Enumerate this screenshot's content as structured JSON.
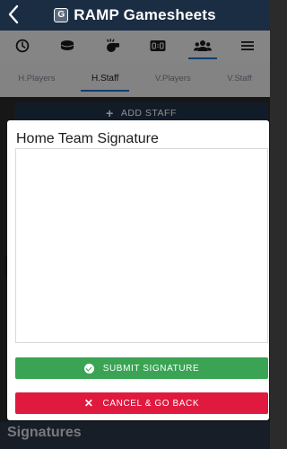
{
  "header": {
    "title": "RAMP Gamesheets",
    "logo_letter": "G",
    "back_icon": "chevron-left-icon"
  },
  "icon_bar": {
    "items": [
      {
        "icon": "clock-icon",
        "active": false
      },
      {
        "icon": "hockey-puck-icon",
        "active": false
      },
      {
        "icon": "whistle-icon",
        "active": false
      },
      {
        "icon": "scoreboard-icon",
        "active": false
      },
      {
        "icon": "team-people-icon",
        "active": true
      },
      {
        "icon": "menu-icon",
        "active": false
      }
    ]
  },
  "tabs": [
    {
      "label": "H.Players",
      "active": false
    },
    {
      "label": "H.Staff",
      "active": true
    },
    {
      "label": "V.Players",
      "active": false
    },
    {
      "label": "V.Staff",
      "active": false
    }
  ],
  "add_staff": {
    "label": "ADD STAFF"
  },
  "modal": {
    "title": "Home Team Signature",
    "submit_label": "SUBMIT SIGNATURE",
    "cancel_label": "CANCEL & GO BACK"
  },
  "footer": {
    "section_label": "Signatures"
  },
  "colors": {
    "header_bg": "#1b2d43",
    "accent": "#1e6fc7",
    "submit": "#3aa454",
    "cancel": "#e0193e"
  }
}
